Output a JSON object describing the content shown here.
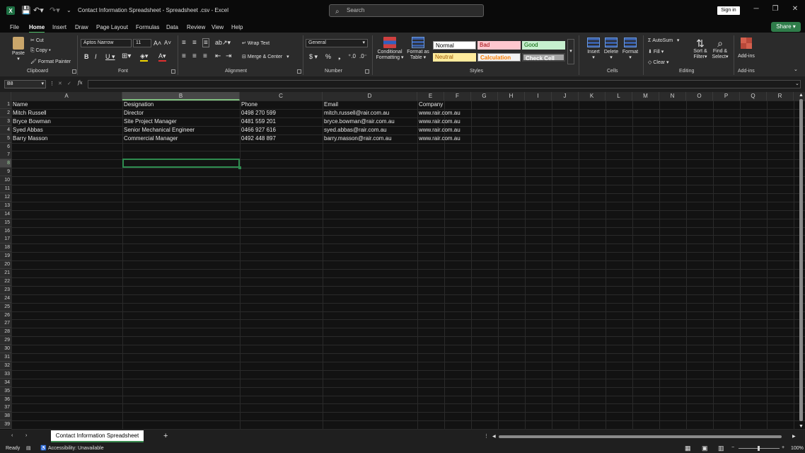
{
  "window": {
    "title": "Contact Information Spreadsheet - Spreadsheet .csv  -  Excel",
    "search_placeholder": "Search",
    "signin_label": "Sign in"
  },
  "menu": {
    "tabs": [
      "File",
      "Home",
      "Insert",
      "Draw",
      "Page Layout",
      "Formulas",
      "Data",
      "Review",
      "View",
      "Help"
    ],
    "share_label": "Share"
  },
  "ribbon": {
    "clipboard": {
      "paste": "Paste",
      "cut": "Cut",
      "copy": "Copy",
      "format_painter": "Format Painter",
      "label": "Clipboard"
    },
    "font": {
      "name": "Aptos Narrow",
      "size": "11",
      "label": "Font"
    },
    "alignment": {
      "wrap": "Wrap Text",
      "merge": "Merge & Center",
      "label": "Alignment"
    },
    "number": {
      "format": "General",
      "label": "Number"
    },
    "styles": {
      "conditional": "Conditional",
      "conditional2": "Formatting",
      "format_table": "Format as",
      "format_table2": "Table",
      "normal": "Normal",
      "bad": "Bad",
      "good": "Good",
      "neutral": "Neutral",
      "calculation": "Calculation",
      "check_cell": "Check Cell",
      "label": "Styles"
    },
    "cells": {
      "insert": "Insert",
      "delete": "Delete",
      "format": "Format",
      "label": "Cells"
    },
    "editing": {
      "autosum": "AutoSum",
      "fill": "Fill",
      "clear": "Clear",
      "sort": "Sort &",
      "sort2": "Filter",
      "find": "Find &",
      "find2": "Select",
      "label": "Editing"
    },
    "addins": {
      "button": "Add-ins",
      "label": "Add-ins"
    }
  },
  "formula_bar": {
    "name_box": "B8",
    "fx": "fx",
    "value": ""
  },
  "columns": [
    "A",
    "B",
    "C",
    "D",
    "E",
    "F",
    "G",
    "H",
    "I",
    "J",
    "K",
    "L",
    "M",
    "N",
    "O",
    "P",
    "Q",
    "R"
  ],
  "rows": [
    [
      "Name",
      "Designation",
      "Phone",
      "Email",
      "Company"
    ],
    [
      "Mitch Russell",
      "Director",
      "0498 270 599",
      "mitch.russell@rair.com.au",
      "www.rair.com.au"
    ],
    [
      "Bryce Bowman",
      "Site Project Manager",
      "0481 559 201",
      "bryce.bowman@rair.com.au",
      "www.rair.com.au"
    ],
    [
      "Syed Abbas",
      "Senior Mechanical Engineer",
      "0466 927 616",
      "syed.abbas@rair.com.au",
      "www.rair.com.au"
    ],
    [
      "Barry Masson",
      "Commercial Manager",
      "0492 448 897",
      "barry.masson@rair.com.au",
      "www.rair.com.au"
    ]
  ],
  "row_count": 39,
  "selected_cell": "B8",
  "sheet_tab": "Contact Information Spreadsheet",
  "status": {
    "ready": "Ready",
    "accessibility": "Accessibility: Unavailable",
    "zoom": "100%"
  }
}
